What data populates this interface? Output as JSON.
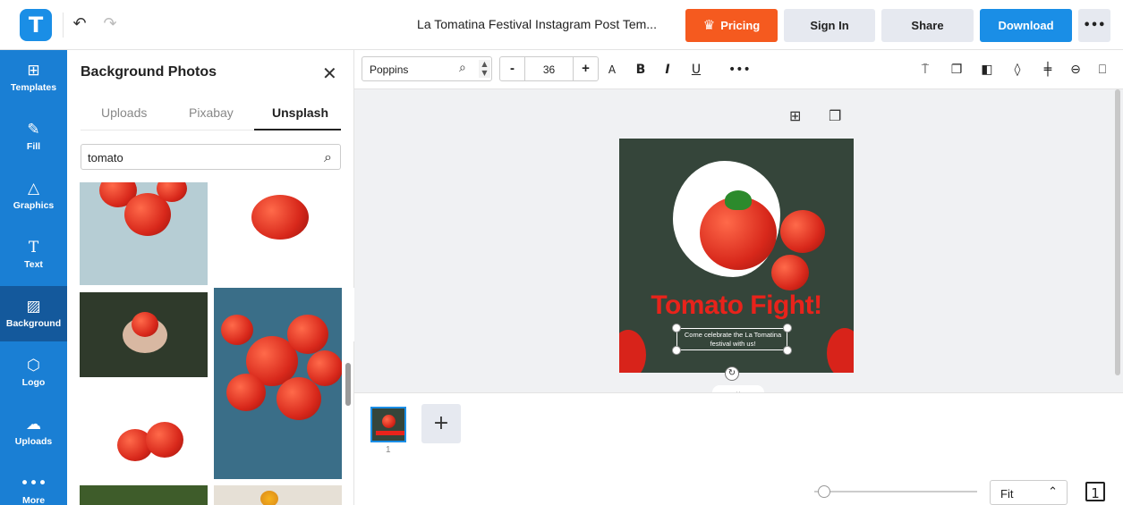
{
  "header": {
    "logo_letter": "T",
    "doc_title": "La Tomatina Festival Instagram Post Tem...",
    "pricing_label": "Pricing",
    "signin_label": "Sign In",
    "share_label": "Share",
    "download_label": "Download",
    "more_label": "•••",
    "accent_color": "#1a8ee6",
    "pricing_color": "#f55a1f"
  },
  "nav": {
    "items": [
      {
        "label": "Templates",
        "icon": "templates-icon"
      },
      {
        "label": "Fill",
        "icon": "pencil-icon"
      },
      {
        "label": "Graphics",
        "icon": "shapes-icon"
      },
      {
        "label": "Text",
        "icon": "text-icon"
      },
      {
        "label": "Background",
        "icon": "background-icon"
      },
      {
        "label": "Logo",
        "icon": "logo-icon"
      },
      {
        "label": "Uploads",
        "icon": "cloud-upload-icon"
      },
      {
        "label": "More",
        "icon": "more-icon"
      }
    ],
    "active": "Background"
  },
  "panel": {
    "title": "Background Photos",
    "tabs": [
      "Uploads",
      "Pixabay",
      "Unsplash"
    ],
    "active_tab": "Unsplash",
    "search_value": "tomato"
  },
  "toolbar": {
    "font_name": "Poppins",
    "font_size": "36",
    "minus_label": "-",
    "plus_label": "+",
    "more_label": "•••"
  },
  "design": {
    "headline": "Tomato Fight!",
    "subtext": "Come celebrate the La Tomatina festival with us!"
  },
  "pages": {
    "current": "1"
  },
  "zoom": {
    "value": "Fit"
  }
}
